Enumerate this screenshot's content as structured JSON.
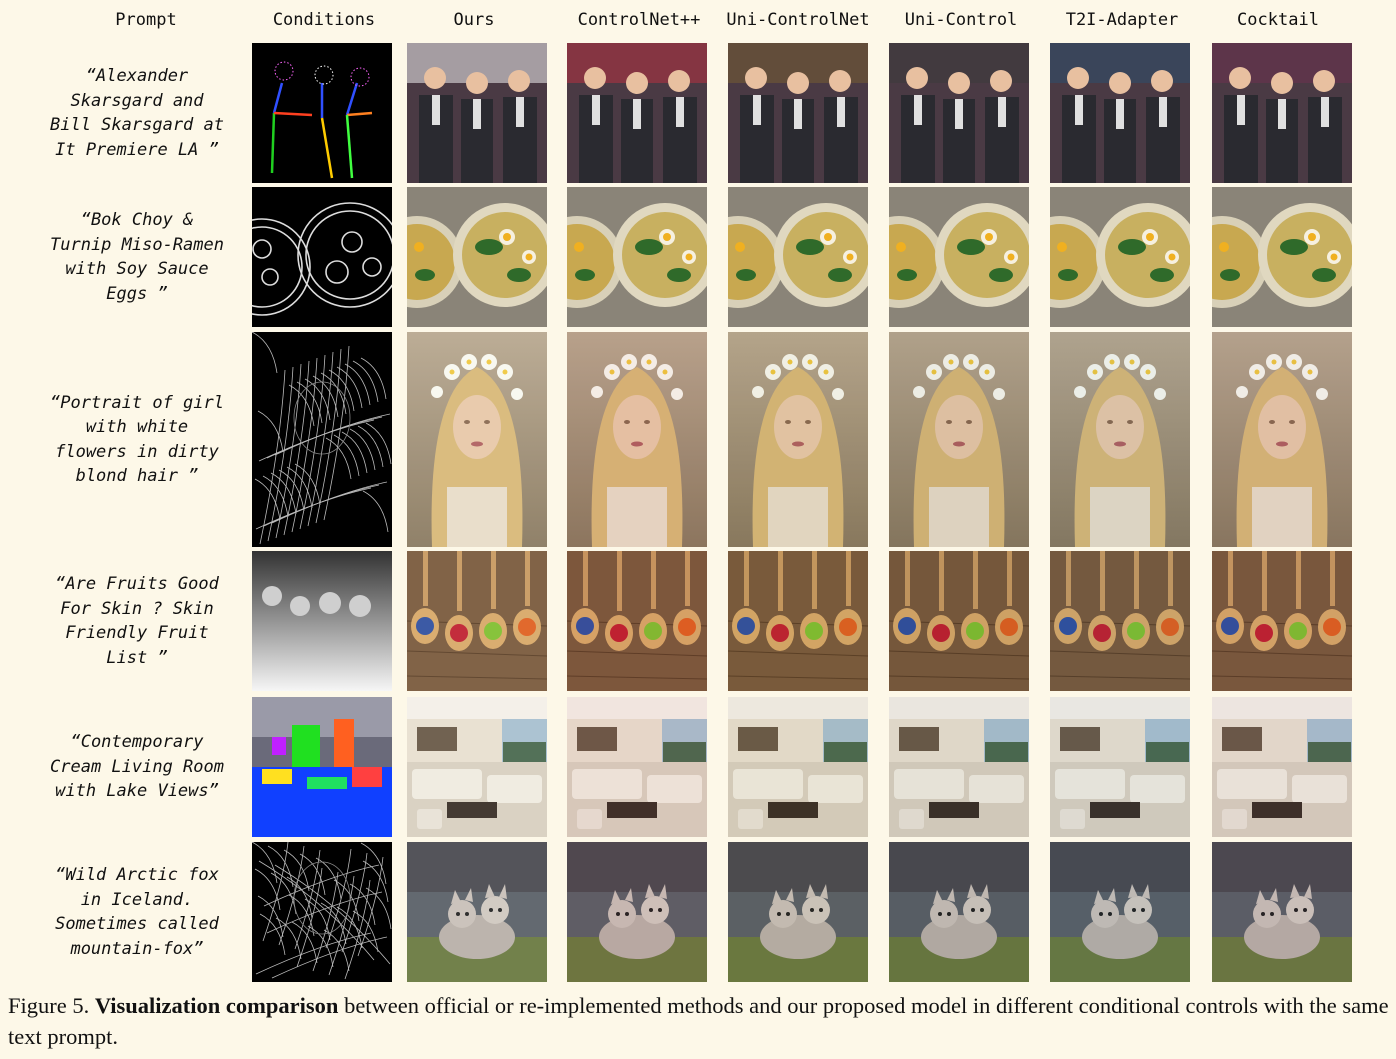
{
  "columns": [
    "Prompt",
    "Conditions",
    "Ours",
    "ControlNet++",
    "Uni-ControlNet",
    "Uni-Control",
    "T2I-Adapter",
    "Cocktail"
  ],
  "rows": [
    {
      "prompt": "“Alexander\nSkarsgard and\nBill Skarsgard at\nIt Premiere LA ”",
      "condition": "pose-skeleton",
      "scene": "red-carpet-people"
    },
    {
      "prompt": "“Bok Choy &\nTurnip Miso-Ramen\nwith Soy Sauce\nEggs ”",
      "condition": "hed-edges",
      "scene": "ramen-bowls"
    },
    {
      "prompt": "“Portrait of girl\nwith white\nflowers in dirty\nblond hair ”",
      "condition": "canny-edges",
      "scene": "girl-portrait"
    },
    {
      "prompt": "“Are Fruits Good\nFor Skin ? Skin\nFriendly Fruit\nList ”",
      "condition": "depth-map",
      "scene": "fruit-spoons"
    },
    {
      "prompt": "“Contemporary\nCream Living Room\nwith Lake Views”",
      "condition": "segmentation-map",
      "scene": "living-room"
    },
    {
      "prompt": "“Wild Arctic fox\nin Iceland.\nSometimes called\nmountain-fox”",
      "condition": "canny-edges",
      "scene": "arctic-fox"
    }
  ],
  "caption": {
    "label": "Figure 5.",
    "bold": "Visualization comparison",
    "text": " between official or re-implemented methods and our proposed model in different conditional controls with the same text prompt."
  },
  "colors": {
    "background": "#fdf8e8",
    "text": "#111111"
  }
}
